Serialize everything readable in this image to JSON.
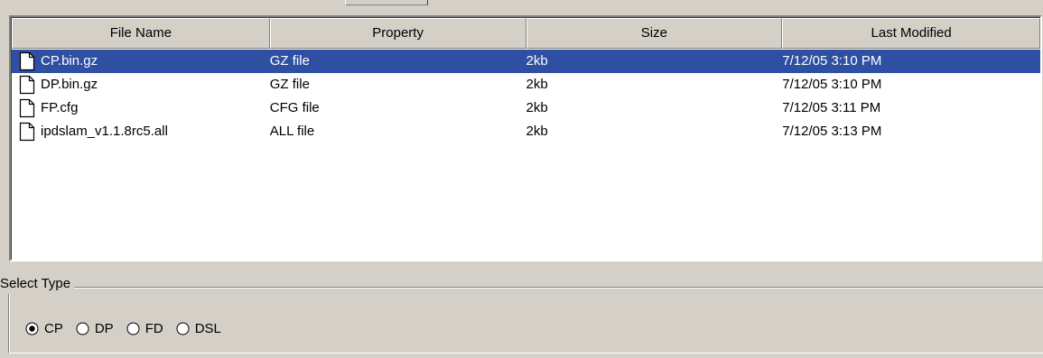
{
  "table": {
    "columns": [
      "File Name",
      "Property",
      "Size",
      "Last Modified"
    ],
    "rows": [
      {
        "name": "CP.bin.gz",
        "property": "GZ file",
        "size": "2kb",
        "modified": "7/12/05 3:10 PM",
        "selected": true,
        "icon": "file-icon"
      },
      {
        "name": "DP.bin.gz",
        "property": "GZ file",
        "size": "2kb",
        "modified": "7/12/05 3:10 PM",
        "selected": false,
        "icon": "file-icon"
      },
      {
        "name": "FP.cfg",
        "property": "CFG file",
        "size": "2kb",
        "modified": "7/12/05 3:11 PM",
        "selected": false,
        "icon": "file-icon"
      },
      {
        "name": "ipdslam_v1.1.8rc5.all",
        "property": "ALL file",
        "size": "2kb",
        "modified": "7/12/05 3:13 PM",
        "selected": false,
        "icon": "file-icon"
      }
    ]
  },
  "select_type": {
    "label": "Select Type",
    "options": [
      {
        "label": "CP",
        "checked": true
      },
      {
        "label": "DP",
        "checked": false
      },
      {
        "label": "FD",
        "checked": false
      },
      {
        "label": "DSL",
        "checked": false
      }
    ]
  },
  "colors": {
    "window_bg": "#d4d0c8",
    "selection_bg": "#2f4fa3",
    "selection_text": "#ffffff"
  }
}
